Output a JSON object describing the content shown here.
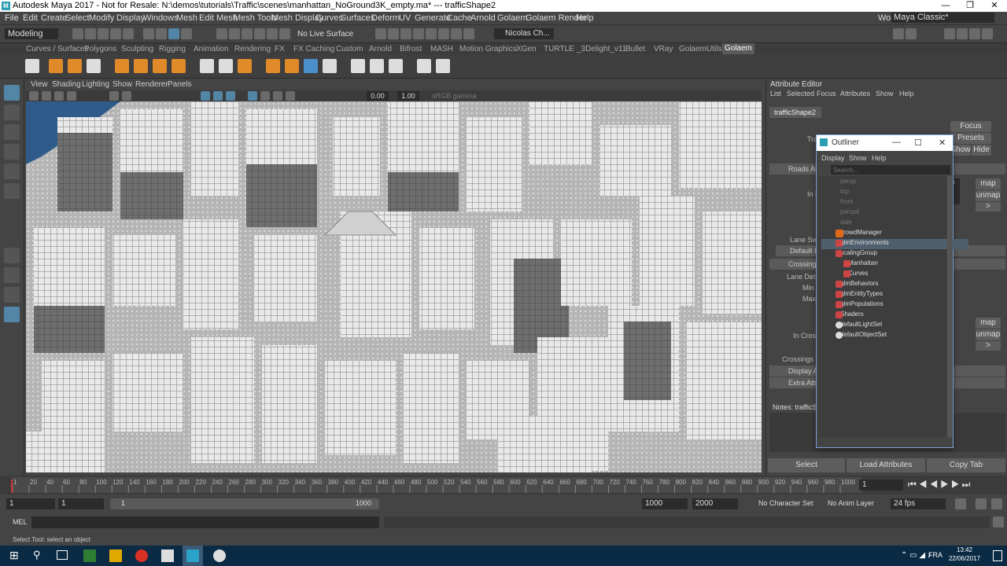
{
  "window": {
    "title": "Autodesk Maya 2017 - Not for Resale: N:\\demos\\tutorials\\Traffic\\scenes\\manhattan_NoGround3K_empty.ma*   ---   trafficShape2",
    "minimize": "—",
    "maximize": "❐",
    "close": "✕"
  },
  "menu": [
    "File",
    "Edit",
    "Create",
    "Select",
    "Modify",
    "Display",
    "Windows",
    "Mesh",
    "Edit Mesh",
    "Mesh Tools",
    "Mesh Display",
    "Curves",
    "Surfaces",
    "Deform",
    "UV",
    "Generate",
    "Cache",
    "Arnold",
    "Golaem",
    "Golaem Render",
    "Help"
  ],
  "workspace": {
    "label": "Workspace :",
    "value": "Maya Classic*"
  },
  "status": {
    "mode": "Modeling",
    "live_surface": "No Live Surface",
    "user": "Nicolas Ch..."
  },
  "shelf_tabs": [
    "Curves / Surfaces",
    "Polygons",
    "Sculpting",
    "Rigging",
    "Animation",
    "Rendering",
    "FX",
    "FX Caching",
    "Custom",
    "Arnold",
    "Bifrost",
    "MASH",
    "Motion Graphics",
    "XGen",
    "TURTLE",
    "_3Delight_v11",
    "Bullet",
    "VRay",
    "GolaemUtils",
    "Golaem"
  ],
  "panel_menu": [
    "View",
    "Shading",
    "Lighting",
    "Show",
    "Renderer",
    "Panels"
  ],
  "panel_toolbar": {
    "value1": "0.00",
    "value2": "1.00",
    "gamma": "sRGB gamma"
  },
  "attribute_editor": {
    "title": "Attribute Editor",
    "menu": [
      "List",
      "Selected",
      "Focus",
      "Attributes",
      "Show",
      "Help"
    ],
    "node_tab": "trafficShape2",
    "focus": "Focus",
    "presets": "Presets",
    "show": "Show",
    "hide": "Hide",
    "tra": "Tra",
    "sections": [
      "Roads Attributes",
      "Default R",
      "Crossing A",
      "Display At",
      "Extra Attri"
    ],
    "labels": [
      "In M",
      "Lane Swit",
      "Lane Detec",
      "Min T",
      "Max T",
      "In Crossi",
      "Crossings Sa"
    ],
    "map": "map",
    "unmap": "unmap",
    "arrow": ">",
    "notes": "Notes:  trafficSh",
    "sh": "Sh",
    "bottom_buttons": [
      "Select",
      "Load Attributes",
      "Copy Tab"
    ]
  },
  "outliner": {
    "title": "Outliner",
    "menu": [
      "Display",
      "Show",
      "Help"
    ],
    "search_placeholder": "Search...",
    "items": [
      "persp",
      "top",
      "front",
      "persp6",
      "side",
      "crowdManager",
      "glmEnvironments",
      "scalingGroup",
      "Manhattan",
      "Curves",
      "glmBehaviors",
      "glmEntityTypes",
      "glmPopulations",
      "Shaders",
      "defaultLightSet",
      "defaultObjectSet"
    ]
  },
  "timeline": {
    "ticks": [
      "1",
      "20",
      "40",
      "60",
      "80",
      "100",
      "120",
      "140",
      "160",
      "180",
      "200",
      "220",
      "240",
      "260",
      "280",
      "300",
      "320",
      "340",
      "360",
      "380",
      "400",
      "420",
      "440",
      "460",
      "480",
      "500",
      "520",
      "540",
      "560",
      "580",
      "600",
      "620",
      "640",
      "660",
      "680",
      "700",
      "720",
      "740",
      "760",
      "780",
      "800",
      "820",
      "840",
      "860",
      "880",
      "900",
      "920",
      "940",
      "960",
      "980",
      "1000"
    ],
    "current": "1"
  },
  "range": {
    "start": "1",
    "start2": "1",
    "slider_start": "1",
    "slider_end": "1000",
    "end": "1000",
    "end2": "2000",
    "character_set": "No Character Set",
    "anim_layer": "No Anim Layer",
    "fps": "24 fps"
  },
  "command": {
    "label": "MEL"
  },
  "help_line": "Select Tool: select an object",
  "taskbar": {
    "lang": "FRA",
    "time": "13:42",
    "date": "22/06/2017"
  },
  "colors": {
    "accent": "#5285a6",
    "selection": "#5285a6",
    "outliner_border": "#7aa6d6",
    "taskbar": "#0b2a44"
  }
}
